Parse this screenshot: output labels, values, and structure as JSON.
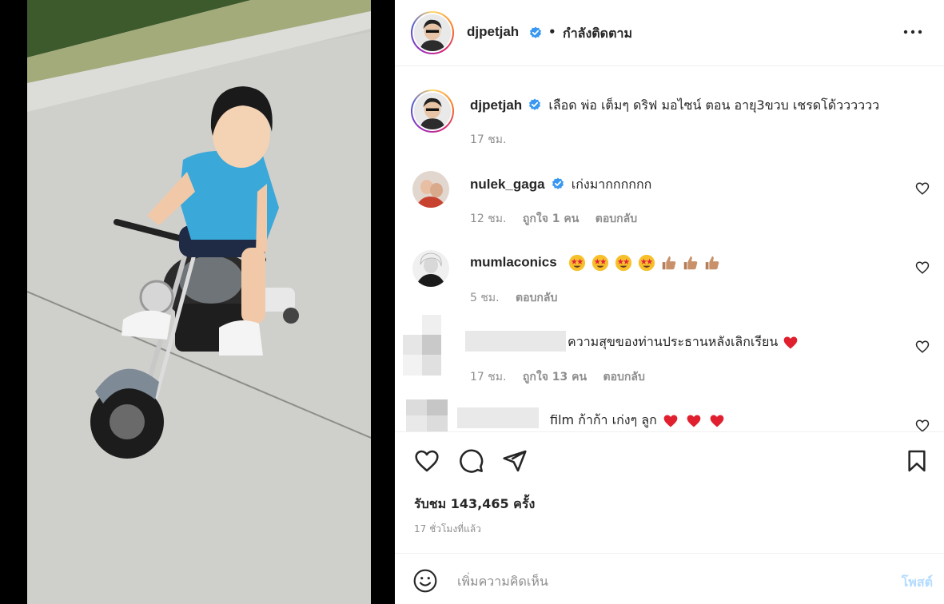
{
  "post": {
    "author": "djpetjah",
    "following_label": "กำลังติดตาม",
    "caption": "เลือด พ่อ เต็มๆ ดริฟ มอไซน์ ตอน อายุ3ขวบ เชรดโด้วววววว",
    "caption_time": "17 ชม."
  },
  "comments": [
    {
      "user": "nulek_gaga",
      "verified": true,
      "text": "เก่งมากกกกกก",
      "time": "12 ชม.",
      "likes": "ถูกใจ 1 คน",
      "reply": "ตอบกลับ"
    },
    {
      "user": "mumlaconics",
      "verified": false,
      "text": "",
      "emoji": [
        "star-struck",
        "star-struck",
        "star-struck",
        "star-struck",
        "thumbs-up",
        "thumbs-up",
        "thumbs-up"
      ],
      "time": "5 ชม.",
      "likes": "",
      "reply": "ตอบกลับ"
    },
    {
      "user": "",
      "verified": false,
      "text": "ความสุขของท่านประธานหลังเลิกเรียน",
      "emoji": [
        "red-heart"
      ],
      "time": "17 ชม.",
      "likes": "ถูกใจ 13 คน",
      "reply": "ตอบกลับ"
    },
    {
      "user": "",
      "verified": false,
      "text": "film ก้าก้า เก่งๆ ลูก",
      "emoji": [
        "red-heart",
        "red-heart",
        "red-heart"
      ],
      "time": "",
      "likes": "",
      "reply": ""
    }
  ],
  "stats": {
    "views": "รับชม 143,465 ครั้ง",
    "time_ago": "17 ชั่วโมงที่แล้ว"
  },
  "composer": {
    "placeholder": "เพิ่มความคิดเห็น",
    "post_label": "โพสต์"
  },
  "colors": {
    "verified": "#3897f0",
    "heart": "#ed4956",
    "post_disabled": "#b3dbff",
    "meta": "#8e8e8e"
  }
}
